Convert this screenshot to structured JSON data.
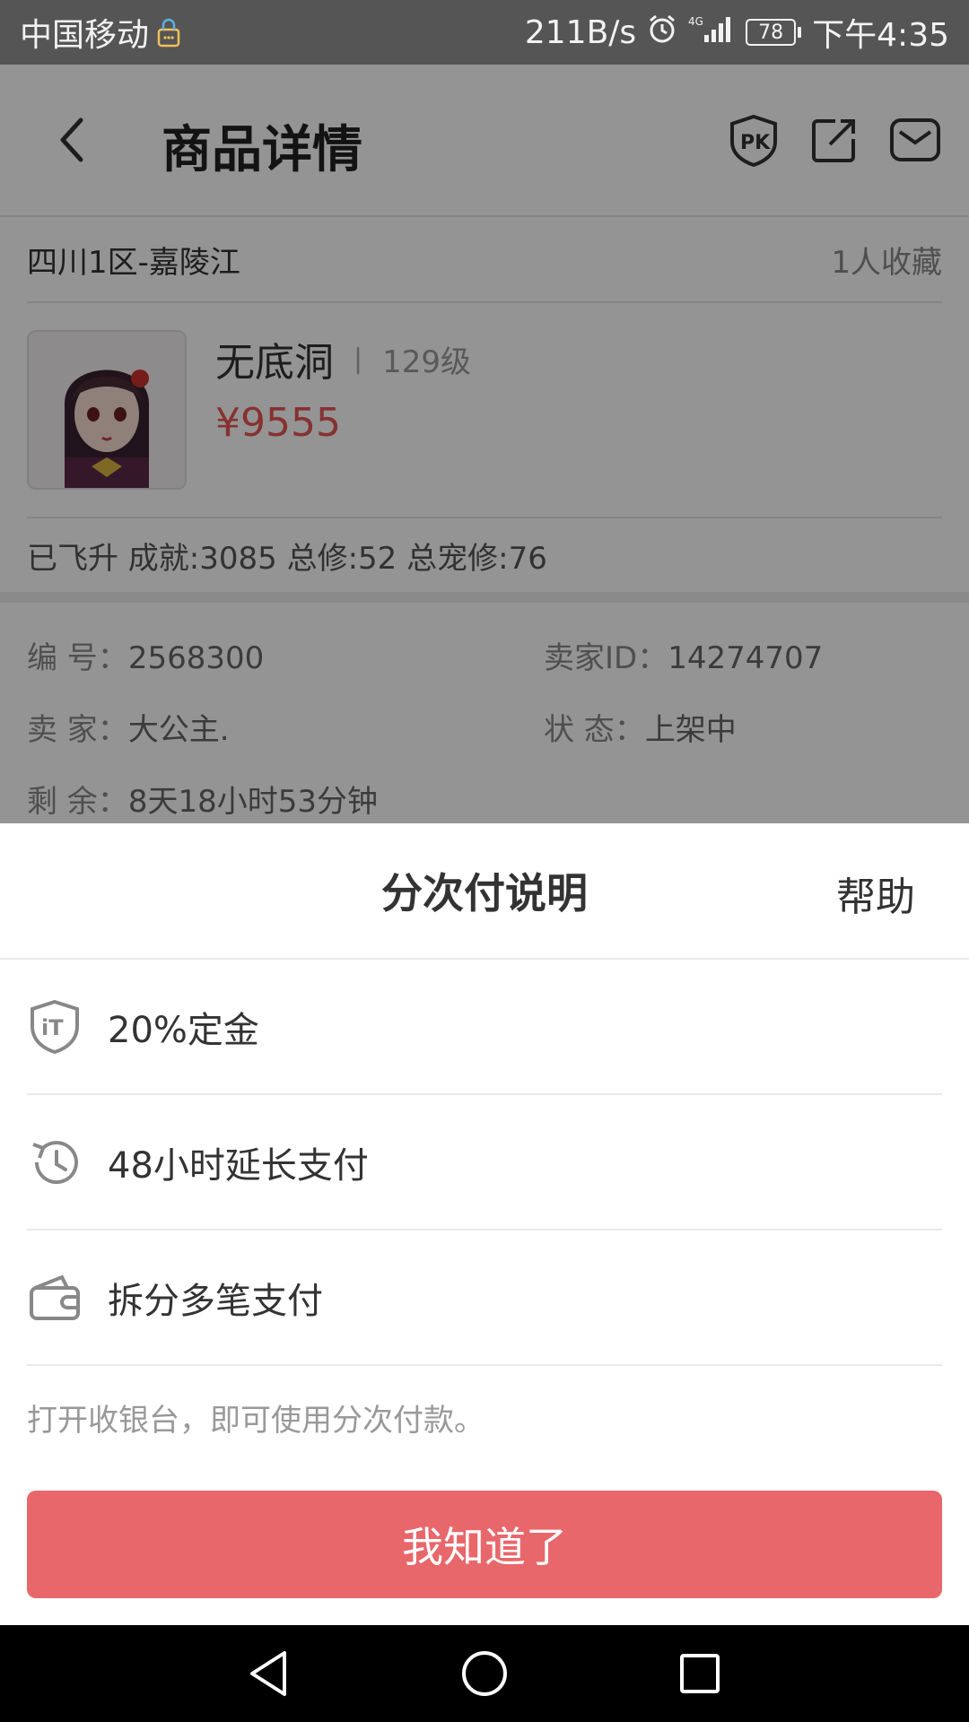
{
  "status_bar": {
    "carrier": "中国移动",
    "network_speed": "211B/s",
    "battery_level": "78",
    "time": "下午4:35",
    "icons": [
      "vpn-lock-icon",
      "alarm-icon",
      "signal-4g-icon",
      "battery-icon"
    ]
  },
  "header": {
    "title": "商品详情",
    "icons": [
      "back-arrow-icon",
      "pk-badge-icon",
      "share-icon",
      "message-icon"
    ]
  },
  "listing": {
    "server": "四川1区-嘉陵江",
    "favorites": "1人收藏",
    "name": "无底洞",
    "separator": "|",
    "level": "129级",
    "price": "¥9555",
    "stats": "已飞升 成就:3085 总修:52 总宠修:76",
    "details": [
      [
        {
          "label": "编 号：",
          "value": "2568300"
        },
        {
          "label": "卖家ID：",
          "value": "14274707"
        }
      ],
      [
        {
          "label": "卖 家：",
          "value": "大公主."
        },
        {
          "label": "状 态：",
          "value": "上架中"
        }
      ],
      [
        {
          "label": "剩 余：",
          "value": "8天18小时53分钟"
        }
      ]
    ]
  },
  "sheet": {
    "title": "分次付说明",
    "help": "帮助",
    "features": [
      {
        "icon": "deposit-shield-icon",
        "label": "20%定金"
      },
      {
        "icon": "history-clock-icon",
        "label": "48小时延长支付"
      },
      {
        "icon": "wallet-icon",
        "label": "拆分多笔支付"
      }
    ],
    "note": "打开收银台，即可使用分次付款。",
    "confirm": "我知道了"
  },
  "colors": {
    "accent": "#e8676b",
    "price": "#e85555",
    "status_bar_bg": "#555555"
  }
}
